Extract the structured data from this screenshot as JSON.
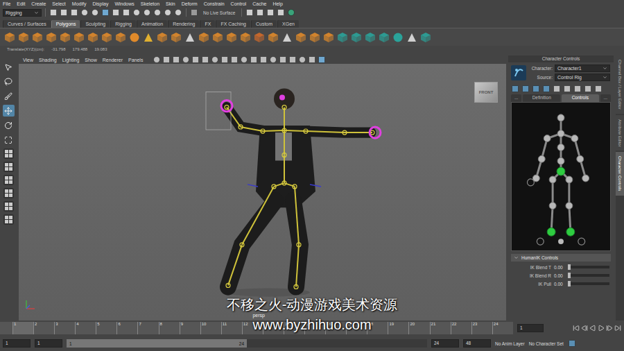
{
  "menu": [
    "File",
    "Edit",
    "Create",
    "Select",
    "Modify",
    "Display",
    "Windows",
    "Skeleton",
    "Skin",
    "Deform",
    "Constrain",
    "Control",
    "Cache",
    "Help"
  ],
  "status_line": {
    "mode": "Rigging",
    "live_surface": "No Live Surface"
  },
  "shelf_tabs": [
    {
      "label": "Curves / Surfaces",
      "selected": false
    },
    {
      "label": "Polygons",
      "selected": true
    },
    {
      "label": "Sculpting",
      "selected": false
    },
    {
      "label": "Rigging",
      "selected": false
    },
    {
      "label": "Animation",
      "selected": false
    },
    {
      "label": "Rendering",
      "selected": false
    },
    {
      "label": "FX",
      "selected": false
    },
    {
      "label": "FX Caching",
      "selected": false
    },
    {
      "label": "Custom",
      "selected": false
    },
    {
      "label": "XGen",
      "selected": false
    }
  ],
  "transform_line": {
    "label": "Translate(XYZ)(cm):",
    "values": [
      "-31.798",
      "179.488",
      "19.083"
    ]
  },
  "viewport": {
    "menu": [
      "View",
      "Shading",
      "Lighting",
      "Show",
      "Renderer",
      "Panels"
    ],
    "camera": "persp",
    "view_cube": "FRONT"
  },
  "watermark": {
    "title": "不移之火-动漫游戏美术资源",
    "url": "www.byzhihuo.com"
  },
  "character_controls": {
    "title": "Character Controls",
    "character_label": "Character:",
    "character": "Character1",
    "source_label": "Source:",
    "source": "Control Rig",
    "tabs": [
      {
        "label": "...",
        "selected": false
      },
      {
        "label": "Definition",
        "selected": false
      },
      {
        "label": "Controls",
        "selected": true
      },
      {
        "label": "...",
        "selected": false
      }
    ],
    "figure_nodes": [
      {
        "selected": false
      },
      {
        "selected": false
      },
      {
        "selected": false
      },
      {
        "selected": false
      },
      {
        "selected": false
      },
      {
        "selected": false
      },
      {
        "selected": false
      },
      {
        "selected": false
      },
      {
        "selected": true
      },
      {
        "selected": false
      },
      {
        "selected": false
      },
      {
        "selected": false
      },
      {
        "selected": false
      },
      {
        "selected": false
      },
      {
        "selected": false
      },
      {
        "selected": true
      },
      {
        "selected": true
      }
    ],
    "section": "HumanIK Controls",
    "sliders": [
      {
        "label": "IK Blend T",
        "value": "0.00",
        "level": 0
      },
      {
        "label": "IK Blend R",
        "value": "0.00",
        "level": 0
      },
      {
        "label": "IK Pull",
        "value": "0.00",
        "level": 0
      }
    ]
  },
  "side_tabs": [
    {
      "label": "Channel Box / Layer Editor",
      "selected": false
    },
    {
      "label": "Attribute Editor",
      "selected": false
    },
    {
      "label": "Character Controls",
      "selected": true
    }
  ],
  "timeline": {
    "ticks": [
      "1",
      "2",
      "3",
      "4",
      "5",
      "6",
      "7",
      "8",
      "9",
      "10",
      "11",
      "12",
      "13",
      "14",
      "15",
      "16",
      "17",
      "18",
      "19",
      "20",
      "21",
      "22",
      "23",
      "24"
    ],
    "current_frame": "1"
  },
  "range": {
    "start": "1",
    "range_start": "1",
    "bar_start": "1",
    "bar_end": "24",
    "range_end": "24",
    "end": "48",
    "anim_layer": "No Anim Layer",
    "character_set": "No Character Set"
  }
}
